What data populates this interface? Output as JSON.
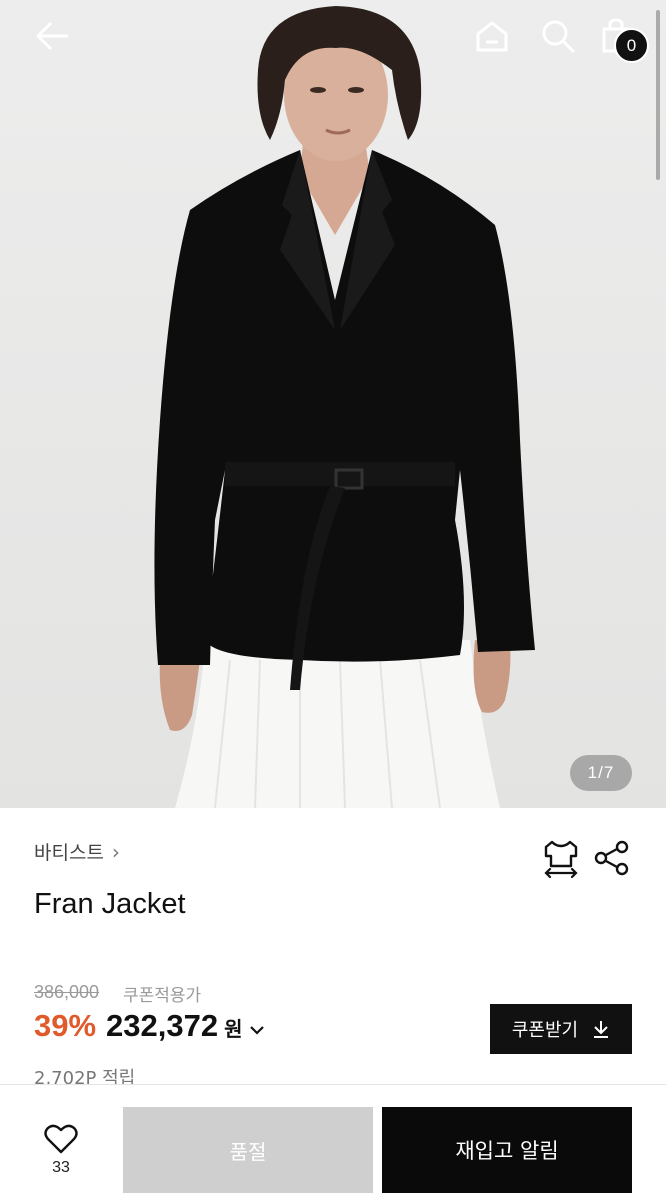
{
  "header": {
    "back_icon": "arrow-left-icon",
    "home_icon": "home-icon",
    "search_icon": "search-icon",
    "cart_icon": "shopping-bag-icon",
    "cart_count": "0"
  },
  "gallery": {
    "counter": "1/7",
    "image_alt": "Model wearing black belted jacket"
  },
  "product": {
    "brand": "바티스트",
    "brand_chevron": "›",
    "name": "Fran Jacket",
    "original_price": "386,000",
    "coupon_note": "쿠폰적용가",
    "discount": "39%",
    "sale_price": "232,372",
    "currency": "원",
    "price_toggle": "⌄",
    "coupon_button": "쿠폰받기",
    "points": "2,702P 적립"
  },
  "bottom_bar": {
    "like_count": "33",
    "soldout_label": "품절",
    "restock_label": "재입고 알림"
  },
  "colors": {
    "accent_discount": "#e05a2b",
    "primary_button": "#0a0a0a",
    "disabled_button": "#cfcfcf"
  }
}
